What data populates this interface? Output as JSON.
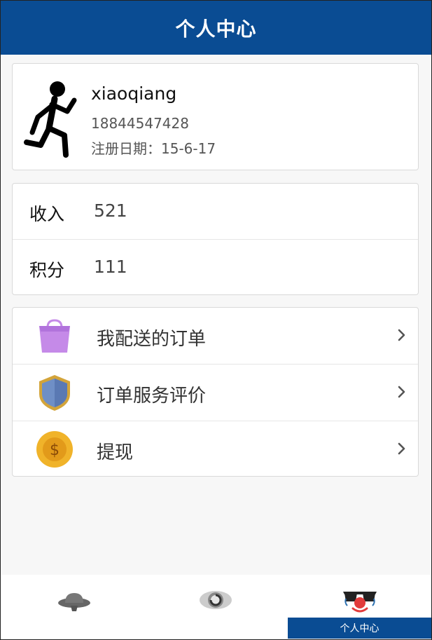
{
  "header": {
    "title": "个人中心"
  },
  "profile": {
    "username": "xiaoqiang",
    "phone": "18844547428",
    "register_date": "注册日期：15-6-17"
  },
  "stats": [
    {
      "label": "收入",
      "value": "521"
    },
    {
      "label": "积分",
      "value": "111"
    }
  ],
  "menu": [
    {
      "label": "我配送的订单",
      "icon": "shopping-bag-icon"
    },
    {
      "label": "订单服务评价",
      "icon": "shield-icon"
    },
    {
      "label": "提现",
      "icon": "coin-dollar-icon"
    }
  ],
  "tabbar": {
    "tabs": [
      {
        "icon": "hat-icon"
      },
      {
        "icon": "eye-icon"
      },
      {
        "icon": "clown-sunglasses-icon",
        "label": "个人中心",
        "active": true
      }
    ]
  },
  "colors": {
    "primary": "#0a4c93",
    "bag": "#c58ae8",
    "shield": "#6f8fc6",
    "coin": "#f0b32a"
  }
}
